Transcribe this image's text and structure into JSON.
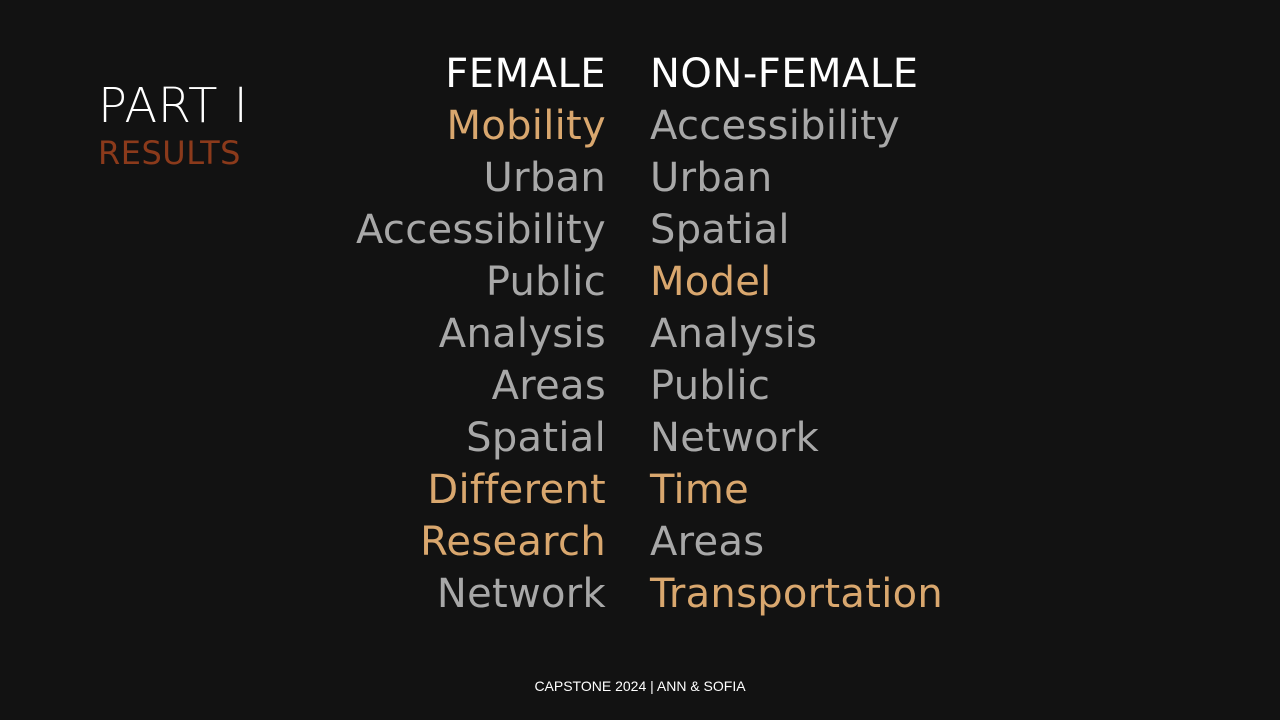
{
  "title": {
    "main": "PART I",
    "sub": "RESULTS"
  },
  "columns": {
    "female": {
      "header": "FEMALE",
      "words": [
        {
          "text": "Mobility",
          "highlight": true
        },
        {
          "text": "Urban",
          "highlight": false
        },
        {
          "text": "Accessibility",
          "highlight": false
        },
        {
          "text": "Public",
          "highlight": false
        },
        {
          "text": "Analysis",
          "highlight": false
        },
        {
          "text": "Areas",
          "highlight": false
        },
        {
          "text": "Spatial",
          "highlight": false
        },
        {
          "text": "Different",
          "highlight": true
        },
        {
          "text": "Research",
          "highlight": true
        },
        {
          "text": "Network",
          "highlight": false
        }
      ]
    },
    "non_female": {
      "header": "NON-FEMALE",
      "words": [
        {
          "text": "Accessibility",
          "highlight": false
        },
        {
          "text": "Urban",
          "highlight": false
        },
        {
          "text": "Spatial",
          "highlight": false
        },
        {
          "text": "Model",
          "highlight": true
        },
        {
          "text": "Analysis",
          "highlight": false
        },
        {
          "text": "Public",
          "highlight": false
        },
        {
          "text": "Network",
          "highlight": false
        },
        {
          "text": "Time",
          "highlight": true
        },
        {
          "text": "Areas",
          "highlight": false
        },
        {
          "text": "Transportation",
          "highlight": true
        }
      ]
    }
  },
  "footer": "CAPSTONE 2024 | ANN & SOFIA",
  "colors": {
    "background": "#121212",
    "highlight": "#d9a76e",
    "normal": "#a8a8a8",
    "subtitle": "#8b3a1b",
    "heading": "#ffffff"
  }
}
